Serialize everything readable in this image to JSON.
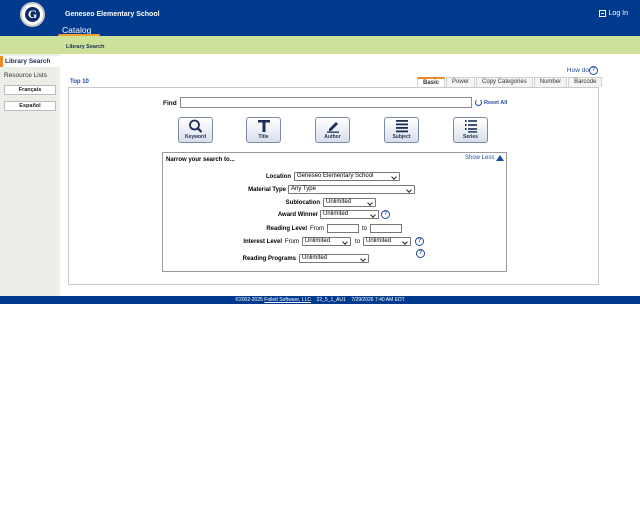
{
  "header": {
    "logo_letter": "G",
    "school_name": "Geneseo Elementary School",
    "catalog_tab": "Catalog",
    "login_label": "Log In"
  },
  "subbar": {
    "label": "Library Search"
  },
  "sidebar": {
    "active_item": "Library Search",
    "resource_lists": "Resource Lists",
    "french": "Français",
    "spanish": "Español"
  },
  "help": {
    "how_do_i": "How do I...",
    "help_glyph": "?"
  },
  "main": {
    "top10": "Top 10",
    "tabs": [
      {
        "label": "Basic",
        "active": true
      },
      {
        "label": "Power",
        "active": false
      },
      {
        "label": "Copy Categories",
        "active": false
      },
      {
        "label": "Number",
        "active": false
      },
      {
        "label": "Barcode",
        "active": false
      }
    ],
    "find_label": "Find",
    "find_value": "",
    "reset_all": "Reset All",
    "search_buttons": [
      {
        "label": "Keyword",
        "icon": "magnifier-icon"
      },
      {
        "label": "Title",
        "icon": "title-t-icon"
      },
      {
        "label": "Author",
        "icon": "pen-icon"
      },
      {
        "label": "Subject",
        "icon": "lines-icon"
      },
      {
        "label": "Series",
        "icon": "numbered-list-icon"
      }
    ]
  },
  "narrow": {
    "title": "Narrow your search to...",
    "show_less": "Show Less",
    "location_label": "Location",
    "location_value": "Geneseo Elementary School",
    "material_type_label": "Material Type",
    "material_type_value": "Any Type",
    "sublocation_label": "Sublocation",
    "sublocation_value": "Unlimited",
    "award_winner_label": "Award Winner",
    "award_winner_value": "Unlimited",
    "reading_level_label": "Reading Level",
    "reading_from": "From",
    "reading_to": "to",
    "interest_level_label": "Interest Level",
    "interest_from": "From",
    "interest_from_value": "Unlimited",
    "interest_to": "to",
    "interest_to_value": "Unlimited",
    "reading_programs_label": "Reading Programs",
    "reading_programs_value": "Unlimited"
  },
  "footer": {
    "copyright": "©2002-2025",
    "company": "Follett Software, LLC",
    "version": "22_5_1_AU1",
    "datetime": "7/29/2026 7:40 AM EDT"
  },
  "colors": {
    "header_blue": "#003a8c",
    "subbar_green": "#cde19a",
    "accent_orange": "#f08a24",
    "link_blue": "#1f4c9c"
  }
}
